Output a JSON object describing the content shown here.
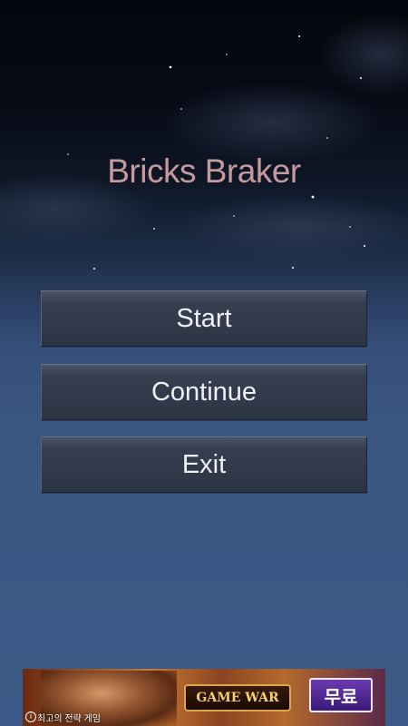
{
  "game": {
    "title": "Bricks Braker"
  },
  "menu": {
    "start_label": "Start",
    "continue_label": "Continue",
    "exit_label": "Exit"
  },
  "ad": {
    "logo_text": "GAME WAR",
    "free_label": "무료",
    "caption": "최고의 전략 게임",
    "info_icon": "info-icon"
  },
  "colors": {
    "title": "#c49a9c",
    "button_text": "#eef0f4",
    "sky_top": "#04060c",
    "sky_bottom": "#3b5a87"
  }
}
